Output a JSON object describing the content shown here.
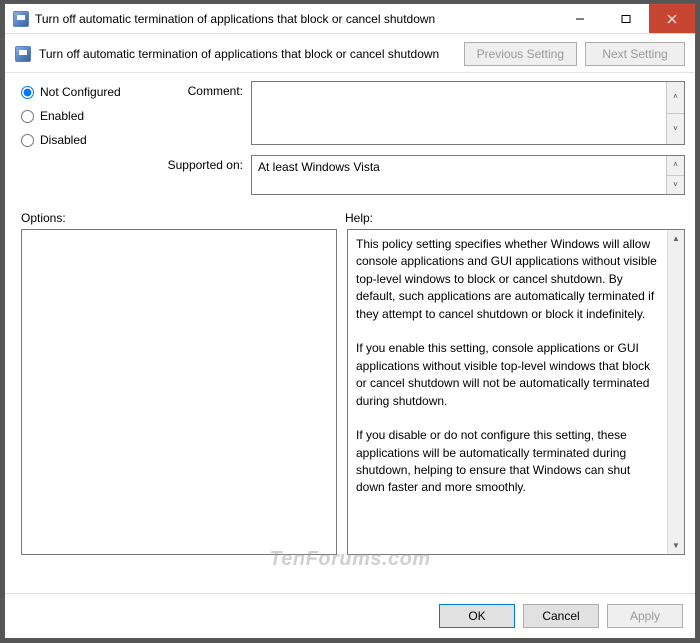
{
  "title": "Turn off automatic termination of applications that block or cancel shutdown",
  "header_title": "Turn off automatic termination of applications that block or cancel shutdown",
  "nav": {
    "prev": "Previous Setting",
    "next": "Next Setting"
  },
  "radios": {
    "not_configured": "Not Configured",
    "enabled": "Enabled",
    "disabled": "Disabled",
    "selected": "not_configured"
  },
  "fields": {
    "comment_label": "Comment:",
    "comment_value": "",
    "supported_label": "Supported on:",
    "supported_value": "At least Windows Vista"
  },
  "labels": {
    "options": "Options:",
    "help": "Help:"
  },
  "help_text": "This policy setting specifies whether Windows will allow console applications and GUI applications without visible top-level windows to block or cancel shutdown. By default, such applications are automatically terminated if they attempt to cancel shutdown or block it indefinitely.\n\nIf you enable this setting, console applications or GUI applications without visible top-level windows that block or cancel shutdown will not be automatically terminated during shutdown.\n\nIf you disable or do not configure this setting, these applications will be automatically terminated during shutdown, helping to ensure that Windows can shut down faster and more smoothly.",
  "footer": {
    "ok": "OK",
    "cancel": "Cancel",
    "apply": "Apply"
  },
  "watermark": "TenForums.com"
}
